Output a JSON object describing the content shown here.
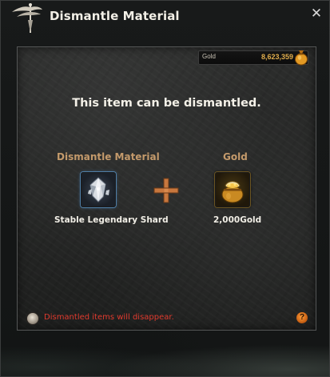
{
  "window": {
    "title": "Dismantle Material",
    "close_label": "✕"
  },
  "gold_bar": {
    "label": "Gold",
    "value": "8,623,359"
  },
  "headline": "This item can be dismantled.",
  "columns": {
    "material_label": "Dismantle Material",
    "gold_label": "Gold"
  },
  "material_item": {
    "name": "Stable Legendary Shard",
    "icon": "crystal-shard-icon"
  },
  "gold_item": {
    "name": "2,000Gold",
    "icon": "gold-pouch-icon"
  },
  "footer": {
    "warning": "Dismantled items will disappear.",
    "help_label": "?"
  },
  "colors": {
    "title": "#f2efe6",
    "gold_value": "#e0ad4c",
    "column_label": "#c49a6b",
    "warning": "#e03a2e",
    "plus": "#c7773e"
  }
}
